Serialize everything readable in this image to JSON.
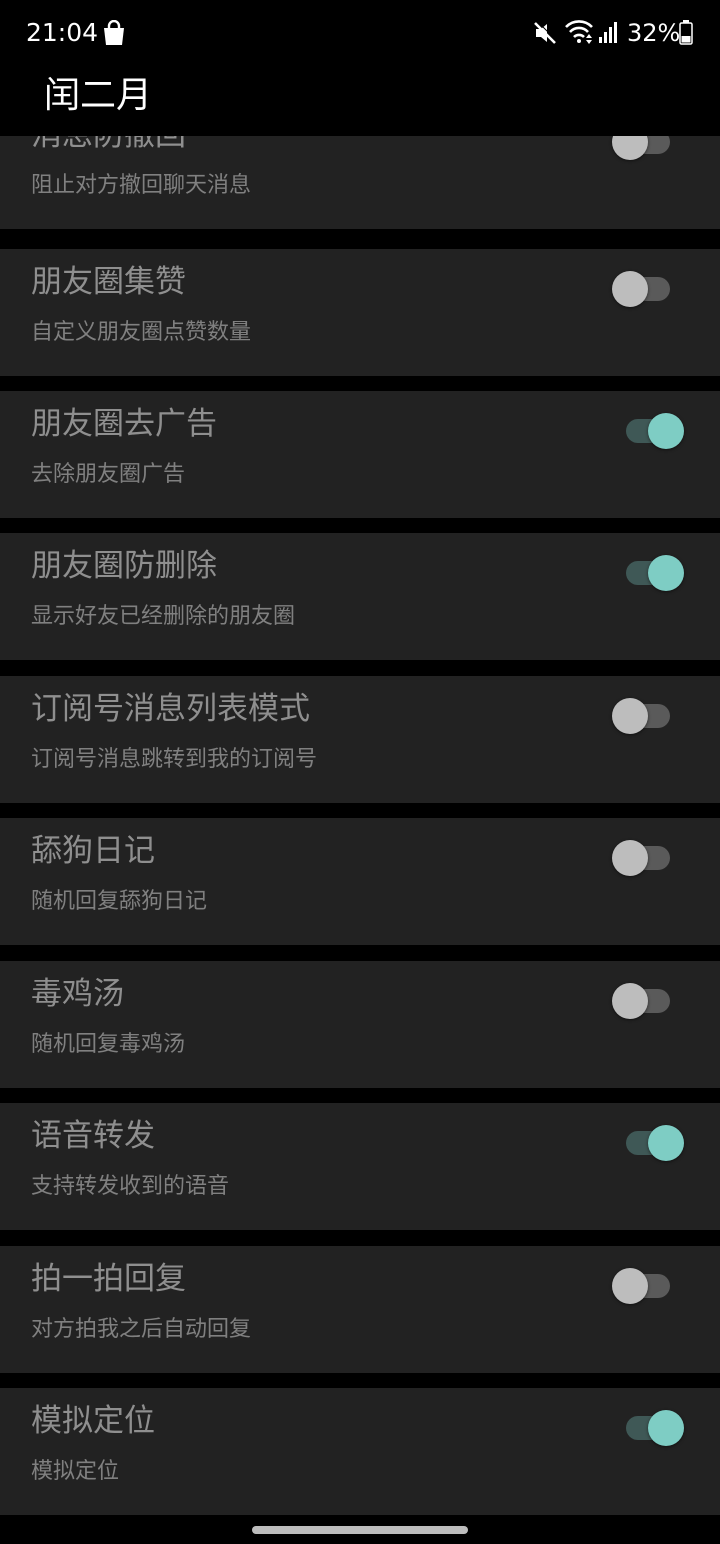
{
  "status_bar": {
    "time": "21:04",
    "battery": "32%",
    "icons": [
      "shopping-bag-icon",
      "mute-icon",
      "wifi-icon",
      "signal-icon",
      "battery-icon"
    ]
  },
  "app_bar": {
    "title": "闰二月"
  },
  "settings": [
    {
      "title": "消息防撤回",
      "desc": "阻止对方撤回聊天消息",
      "enabled": false
    },
    {
      "title": "朋友圈集赞",
      "desc": "自定义朋友圈点赞数量",
      "enabled": false
    },
    {
      "title": "朋友圈去广告",
      "desc": "去除朋友圈广告",
      "enabled": true
    },
    {
      "title": "朋友圈防删除",
      "desc": "显示好友已经删除的朋友圈",
      "enabled": true
    },
    {
      "title": "订阅号消息列表模式",
      "desc": "订阅号消息跳转到我的订阅号",
      "enabled": false
    },
    {
      "title": "舔狗日记",
      "desc": "随机回复舔狗日记",
      "enabled": false
    },
    {
      "title": "毒鸡汤",
      "desc": "随机回复毒鸡汤",
      "enabled": false
    },
    {
      "title": "语音转发",
      "desc": "支持转发收到的语音",
      "enabled": true
    },
    {
      "title": "拍一拍回复",
      "desc": "对方拍我之后自动回复",
      "enabled": false
    },
    {
      "title": "模拟定位",
      "desc": "模拟定位",
      "enabled": true
    }
  ],
  "colors": {
    "background": "#000000",
    "card": "#222222",
    "toggle_on_thumb": "#7ecdc4",
    "toggle_on_track": "#3f5856",
    "toggle_off_thumb": "#bdbdbd",
    "toggle_off_track": "#5a5a5a"
  }
}
